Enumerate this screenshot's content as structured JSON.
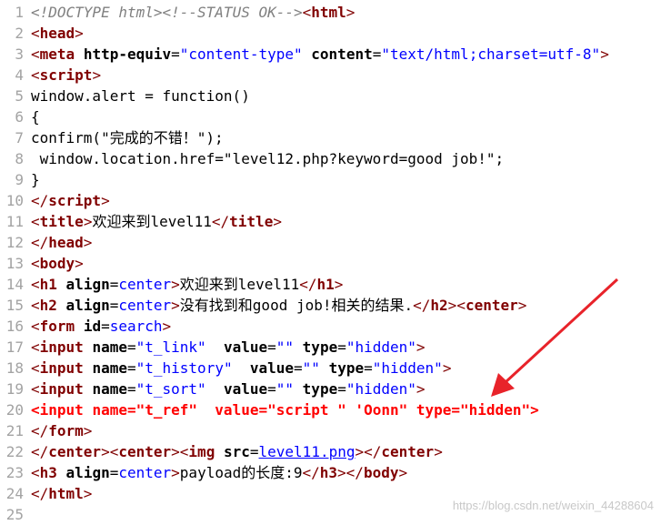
{
  "lines": [
    {
      "num": "1",
      "parts": [
        "<!DOCTYPE html>",
        "<!--STATUS OK-->",
        "<",
        "html",
        ">"
      ]
    },
    {
      "num": "2",
      "parts": [
        "<",
        "head",
        ">"
      ]
    },
    {
      "num": "3",
      "parts": [
        "<",
        "meta",
        " ",
        "http-equiv",
        "=",
        "\"content-type\"",
        " ",
        "content",
        "=",
        "\"text/html;charset=utf-8\"",
        ">"
      ]
    },
    {
      "num": "4",
      "parts": [
        "<",
        "script",
        ">"
      ]
    },
    {
      "num": "5",
      "parts": [
        "window.alert = function()"
      ]
    },
    {
      "num": "6",
      "parts": [
        "{"
      ]
    },
    {
      "num": "7",
      "parts": [
        "confirm(\"完成的不错！\");"
      ]
    },
    {
      "num": "8",
      "parts": [
        " window.location.href=\"level12.php?keyword=good job!\";"
      ]
    },
    {
      "num": "9",
      "parts": [
        "}"
      ]
    },
    {
      "num": "10",
      "parts": [
        "</",
        "script",
        ">"
      ]
    },
    {
      "num": "11",
      "parts": [
        "<",
        "title",
        ">",
        "欢迎来到level11",
        "</",
        "title",
        ">"
      ]
    },
    {
      "num": "12",
      "parts": [
        "</",
        "head",
        ">"
      ]
    },
    {
      "num": "13",
      "parts": [
        "<",
        "body",
        ">"
      ]
    },
    {
      "num": "14",
      "parts": [
        "<",
        "h1",
        " ",
        "align",
        "=",
        "center",
        ">",
        "欢迎来到level11",
        "</",
        "h1",
        ">"
      ]
    },
    {
      "num": "15",
      "parts": [
        "<",
        "h2",
        " ",
        "align",
        "=",
        "center",
        ">",
        "没有找到和good job!相关的结果.",
        "</",
        "h2",
        ">",
        "<",
        "center",
        ">"
      ]
    },
    {
      "num": "16",
      "parts": [
        "<",
        "form",
        " ",
        "id",
        "=",
        "search",
        ">"
      ]
    },
    {
      "num": "17",
      "parts": [
        "<",
        "input",
        " ",
        "name",
        "=",
        "\"t_link\"",
        "  ",
        "value",
        "=",
        "\"\"",
        " ",
        "type",
        "=",
        "\"hidden\"",
        ">"
      ]
    },
    {
      "num": "18",
      "parts": [
        "<",
        "input",
        " ",
        "name",
        "=",
        "\"t_history\"",
        "  ",
        "value",
        "=",
        "\"\"",
        " ",
        "type",
        "=",
        "\"hidden\"",
        ">"
      ]
    },
    {
      "num": "19",
      "parts": [
        "<",
        "input",
        " ",
        "name",
        "=",
        "\"t_sort\"",
        "  ",
        "value",
        "=",
        "\"\"",
        " ",
        "type",
        "=",
        "\"hidden\"",
        ">"
      ]
    },
    {
      "num": "20",
      "parts": [
        "<input ",
        "name",
        "=\"t_ref\"  ",
        "value",
        "=\"script \" 'Oonn\" ",
        "type",
        "=\"hidden\">"
      ]
    },
    {
      "num": "21",
      "parts": [
        "</",
        "form",
        ">"
      ]
    },
    {
      "num": "22",
      "parts": [
        "</",
        "center",
        ">",
        "<",
        "center",
        ">",
        "<",
        "img",
        " ",
        "src",
        "=",
        "level11.png",
        ">",
        "</",
        "center",
        ">"
      ]
    },
    {
      "num": "23",
      "parts": [
        "<",
        "h3",
        " ",
        "align",
        "=",
        "center",
        ">",
        "payload的长度:9",
        "</",
        "h3",
        ">",
        "</",
        "body",
        ">"
      ]
    },
    {
      "num": "24",
      "parts": [
        "</",
        "html",
        ">"
      ]
    },
    {
      "num": "25",
      "parts": []
    }
  ],
  "watermark": "https://blog.csdn.net/weixin_44288604",
  "colors": {
    "tag": "#800000",
    "attr": "#000000",
    "value": "#0000ff",
    "highlight": "#ff0000",
    "comment": "#808080",
    "gutter": "#a3a3a3"
  }
}
